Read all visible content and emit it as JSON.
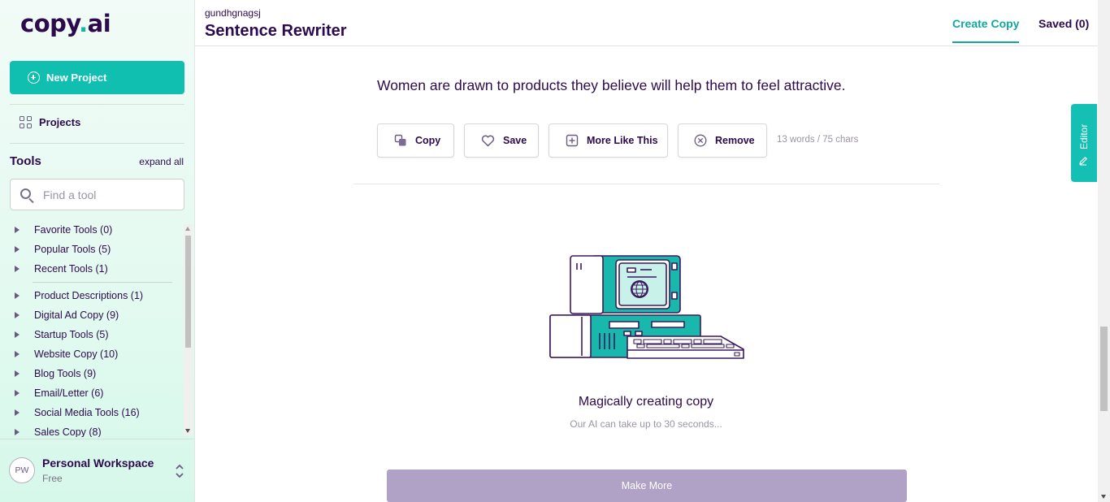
{
  "sidebar": {
    "logo": {
      "text_main": "copy",
      "text_dot": ".",
      "text_tail": "ai"
    },
    "new_project_label": "New Project",
    "projects_label": "Projects",
    "tools_heading": "Tools",
    "expand_all_label": "expand all",
    "search_placeholder": "Find a tool",
    "tool_groups_top": [
      {
        "label": "Favorite Tools (0)"
      },
      {
        "label": "Popular Tools (5)"
      },
      {
        "label": "Recent Tools (1)"
      }
    ],
    "tool_groups": [
      {
        "label": "Product Descriptions (1)"
      },
      {
        "label": "Digital Ad Copy (9)"
      },
      {
        "label": "Startup Tools (5)"
      },
      {
        "label": "Website Copy (10)"
      },
      {
        "label": "Blog Tools (9)"
      },
      {
        "label": "Email/Letter (6)"
      },
      {
        "label": "Social Media Tools (16)"
      },
      {
        "label": "Sales Copy (8)"
      }
    ],
    "workspace": {
      "initials": "PW",
      "name": "Personal Workspace",
      "plan": "Free"
    }
  },
  "header": {
    "project_name": "gundhgnagsj",
    "page_title": "Sentence Rewriter",
    "tabs": {
      "create": "Create Copy",
      "saved": "Saved (0)"
    }
  },
  "result": {
    "text": "Women are drawn to products they believe will help them to feel attractive.",
    "actions": {
      "copy": "Copy",
      "save": "Save",
      "more_like_this": "More Like This",
      "remove": "Remove"
    },
    "counts": "13 words / 75 chars"
  },
  "loading": {
    "title": "Magically creating copy",
    "subtitle": "Our AI can take up to 30 seconds..."
  },
  "make_more_label": "Make More",
  "editor_tab_label": "Editor",
  "colors": {
    "accent": "#10bfb0",
    "brand_text": "#2d0a4e",
    "disabled_button": "#b0a2c7"
  }
}
